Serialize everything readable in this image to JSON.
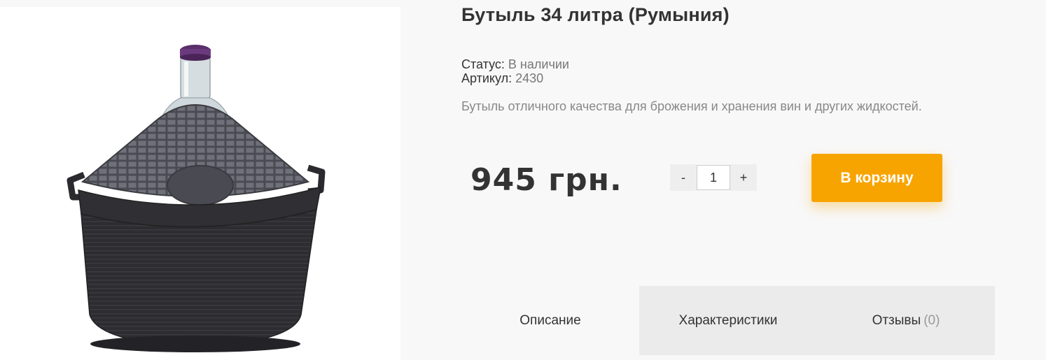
{
  "product": {
    "title": "Бутыль 34 литра (Румыния)",
    "status_label": "Статус:",
    "status_value": "В наличии",
    "sku_label": "Артикул:",
    "sku_value": "2430",
    "description": "Бутыль отличного качества для брожения и хранения вин и других жидкостей.",
    "price": "945 грн.",
    "image_alt": "Glass bottle in black plastic basket with purple cap"
  },
  "quantity": {
    "minus_label": "-",
    "value": "1",
    "plus_label": "+"
  },
  "cart_button": {
    "label": "В корзину",
    "color": "#f7a400"
  },
  "tabs": [
    {
      "label": "Описание",
      "count": ""
    },
    {
      "label": "Характеристики",
      "count": ""
    },
    {
      "label": "Отзывы",
      "count": "(0)"
    }
  ]
}
